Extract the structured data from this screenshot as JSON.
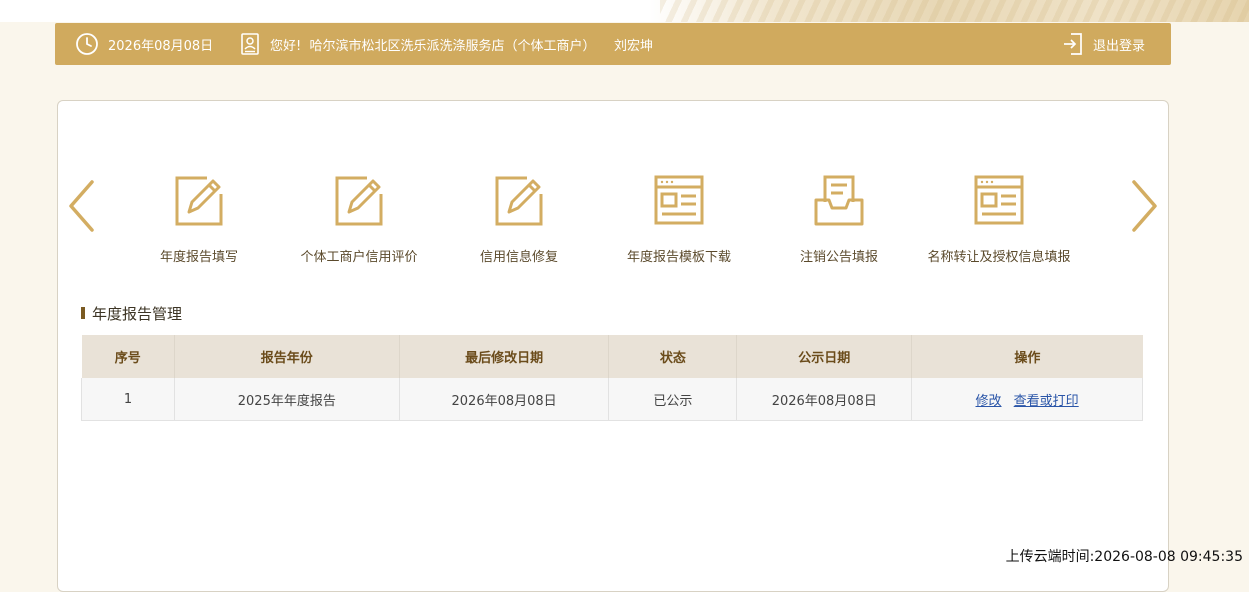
{
  "header": {
    "date": "2026年08月08日",
    "greeting": "您好!  哈尔滨市松北区洗乐派洗涤服务店（个体工商户）",
    "user_name": "刘宏坤",
    "logout_label": "退出登录",
    "icons": [
      "clock-icon",
      "user-card-icon",
      "logout-icon"
    ]
  },
  "nav": {
    "prev_icon": "chevron-left-icon",
    "next_icon": "chevron-right-icon",
    "items": [
      {
        "label": "年度报告填写",
        "icon": "edit-pencil-icon"
      },
      {
        "label": "个体工商户信用评价",
        "icon": "edit-pencil-icon"
      },
      {
        "label": "信用信息修复",
        "icon": "edit-pencil-icon"
      },
      {
        "label": "年度报告模板下载",
        "icon": "document-template-icon"
      },
      {
        "label": "注销公告填报",
        "icon": "inbox-document-icon"
      },
      {
        "label": "名称转让及授权信息填报",
        "icon": "document-template-icon"
      }
    ]
  },
  "section": {
    "title": "年度报告管理"
  },
  "table": {
    "headers": [
      "序号",
      "报告年份",
      "最后修改日期",
      "状态",
      "公示日期",
      "操作"
    ],
    "rows": [
      {
        "index": "1",
        "year": "2025年年度报告",
        "modified": "2026年08月08日",
        "status": "已公示",
        "publish_date": "2026年08月08日",
        "actions": [
          "修改",
          "查看或打印"
        ]
      }
    ]
  },
  "footer": {
    "upload_time": "上传云端时间:2026-08-08 09:45:35"
  },
  "colors": {
    "header_bg": "#d0aa5e",
    "icon_gold": "#d3ad62",
    "table_header_bg": "#e9e2d7",
    "link": "#2a55a8"
  }
}
